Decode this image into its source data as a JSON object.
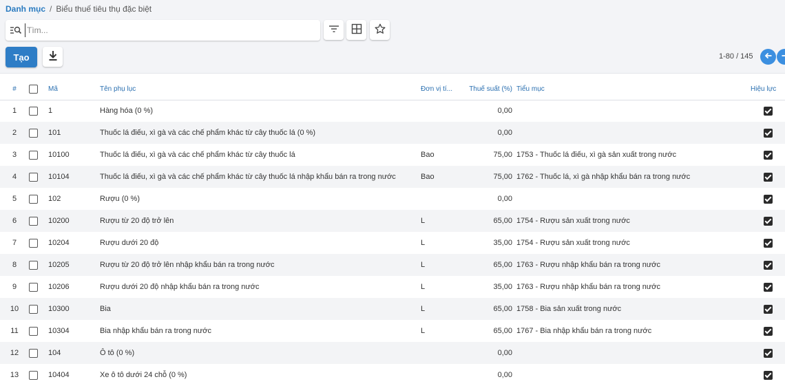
{
  "breadcrumb": {
    "root": "Danh mục",
    "sep": "/",
    "current": "Biểu thuế tiêu thụ đặc biệt"
  },
  "search": {
    "placeholder": "Tìm...",
    "value": ""
  },
  "actions": {
    "create_label": "Tạo"
  },
  "pager": {
    "range": "1-80 / 145"
  },
  "columns": {
    "index": "#",
    "code": "Mã",
    "name": "Tên phụ lục",
    "unit": "Đơn vị tí...",
    "rate": "Thuế suất (%)",
    "subitem": "Tiểu mục",
    "effective": "Hiệu lực"
  },
  "rows": [
    {
      "index": "1",
      "code": "1",
      "name": "Hàng hóa (0 %)",
      "unit": "",
      "rate": "0,00",
      "subitem": "",
      "effective": true
    },
    {
      "index": "2",
      "code": "101",
      "name": "Thuốc lá điếu, xì gà và các chế phẩm khác từ cây thuốc lá (0 %)",
      "unit": "",
      "rate": "0,00",
      "subitem": "",
      "effective": true
    },
    {
      "index": "3",
      "code": "10100",
      "name": "Thuốc lá điếu, xì gà và các chế phẩm khác từ cây thuốc lá",
      "unit": "Bao",
      "rate": "75,00",
      "subitem": "1753 - Thuốc lá điếu, xì gà sản xuất trong nước",
      "effective": true
    },
    {
      "index": "4",
      "code": "10104",
      "name": "Thuốc lá điếu, xì gà và các chế phẩm khác từ cây thuốc lá nhập khẩu bán ra trong nước",
      "unit": "Bao",
      "rate": "75,00",
      "subitem": "1762 - Thuốc lá, xì gà nhập khẩu bán ra trong nước",
      "effective": true
    },
    {
      "index": "5",
      "code": "102",
      "name": "Rượu (0 %)",
      "unit": "",
      "rate": "0,00",
      "subitem": "",
      "effective": true
    },
    {
      "index": "6",
      "code": "10200",
      "name": "Rượu từ 20 độ trở lên",
      "unit": "L",
      "rate": "65,00",
      "subitem": "1754 - Rượu sản xuất trong nước",
      "effective": true
    },
    {
      "index": "7",
      "code": "10204",
      "name": "Rượu dưới 20 độ",
      "unit": "L",
      "rate": "35,00",
      "subitem": "1754 - Rượu sản xuất trong nước",
      "effective": true
    },
    {
      "index": "8",
      "code": "10205",
      "name": "Rượu từ 20 độ trở lên nhập khẩu bán ra trong nước",
      "unit": "L",
      "rate": "65,00",
      "subitem": "1763 - Rượu nhập khẩu bán ra trong nước",
      "effective": true
    },
    {
      "index": "9",
      "code": "10206",
      "name": "Rượu dưới 20 độ nhập khẩu bán ra trong nước",
      "unit": "L",
      "rate": "35,00",
      "subitem": "1763 - Rượu nhập khẩu bán ra trong nước",
      "effective": true
    },
    {
      "index": "10",
      "code": "10300",
      "name": "Bia",
      "unit": "L",
      "rate": "65,00",
      "subitem": "1758 - Bia sản xuất trong nước",
      "effective": true
    },
    {
      "index": "11",
      "code": "10304",
      "name": "Bia nhập khẩu bán ra trong nước",
      "unit": "L",
      "rate": "65,00",
      "subitem": "1767 - Bia nhập khẩu bán ra trong nước",
      "effective": true
    },
    {
      "index": "12",
      "code": "104",
      "name": "Ô tô (0 %)",
      "unit": "",
      "rate": "0,00",
      "subitem": "",
      "effective": true
    },
    {
      "index": "13",
      "code": "10404",
      "name": "Xe ô tô dưới 24 chỗ (0 %)",
      "unit": "",
      "rate": "0,00",
      "subitem": "",
      "effective": true
    }
  ],
  "colors": {
    "accent": "#2e7dc6",
    "header_text": "#2a6fb0",
    "stripe": "#f3f4f6",
    "topbar": "#f3f4f7"
  },
  "icons": {
    "search": "search-list-icon",
    "filter": "filter-icon",
    "columns": "grid-icon",
    "favorite": "star-icon",
    "download": "download-icon",
    "prev": "arrow-left-icon",
    "next": "arrow-right-icon"
  }
}
